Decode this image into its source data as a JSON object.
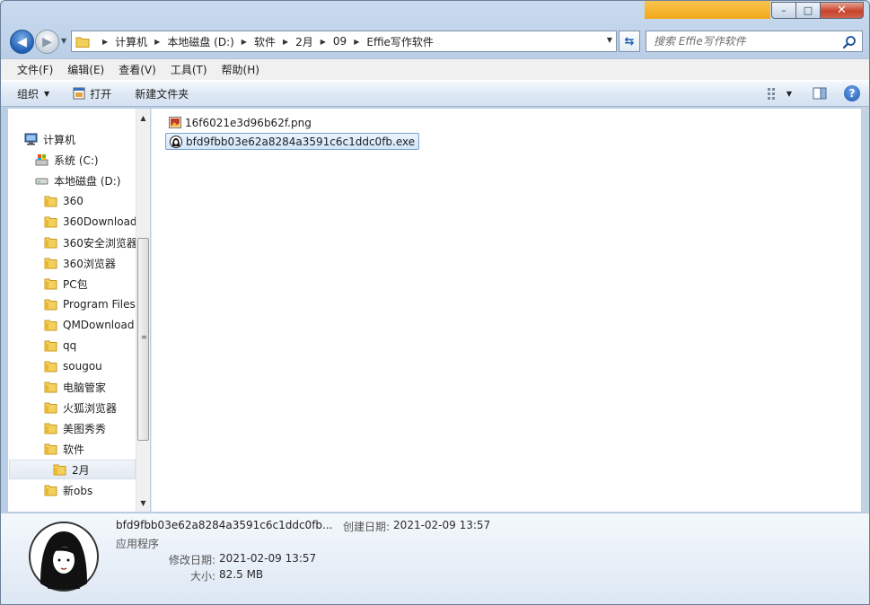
{
  "window": {
    "controls": {
      "minimize": "–",
      "maximize": "□",
      "close": "✕"
    }
  },
  "address": {
    "crumbs": [
      "计算机",
      "本地磁盘 (D:)",
      "软件",
      "2月",
      "09",
      "Effie写作软件"
    ],
    "search_placeholder": "搜索 Effie写作软件"
  },
  "menubar": [
    "文件(F)",
    "编辑(E)",
    "查看(V)",
    "工具(T)",
    "帮助(H)"
  ],
  "commands": {
    "organize": "组织",
    "open": "打开",
    "new_folder": "新建文件夹"
  },
  "nav_tree": [
    {
      "label": "计算机",
      "icon": "computer-icon"
    },
    {
      "label": "系统 (C:)",
      "icon": "system-drive-icon"
    },
    {
      "label": "本地磁盘 (D:)",
      "icon": "drive-icon"
    },
    {
      "label": "360",
      "icon": "folder-icon"
    },
    {
      "label": "360Download",
      "icon": "folder-icon"
    },
    {
      "label": "360安全浏览器",
      "icon": "folder-icon"
    },
    {
      "label": "360浏览器",
      "icon": "folder-icon"
    },
    {
      "label": "PC包",
      "icon": "folder-icon"
    },
    {
      "label": "Program Files",
      "icon": "folder-icon"
    },
    {
      "label": "QMDownload",
      "icon": "folder-icon"
    },
    {
      "label": "qq",
      "icon": "folder-icon"
    },
    {
      "label": "sougou",
      "icon": "folder-icon"
    },
    {
      "label": "电脑管家",
      "icon": "folder-icon"
    },
    {
      "label": "火狐浏览器",
      "icon": "folder-icon"
    },
    {
      "label": "美图秀秀",
      "icon": "folder-icon"
    },
    {
      "label": "软件",
      "icon": "folder-icon"
    },
    {
      "label": "2月",
      "icon": "folder-icon",
      "selected": true
    },
    {
      "label": "新obs",
      "icon": "folder-icon"
    }
  ],
  "files": [
    {
      "name": "16f6021e3d96b62f.png",
      "icon": "png-image-icon"
    },
    {
      "name": "bfd9fbb03e62a8284a3591c6c1ddc0fb.exe",
      "icon": "exe-app-icon",
      "selected": true
    }
  ],
  "details": {
    "name": "bfd9fbb03e62a8284a3591c6c1ddc0fb...",
    "type": "应用程序",
    "created_label": "创建日期:",
    "created_value": "2021-02-09 13:57",
    "modified_label": "修改日期:",
    "modified_value": "2021-02-09 13:57",
    "size_label": "大小:",
    "size_value": "82.5 MB"
  },
  "colors": {
    "accent": "#f6a400",
    "selection": "#d2e6fa",
    "close": "#c7432b"
  }
}
